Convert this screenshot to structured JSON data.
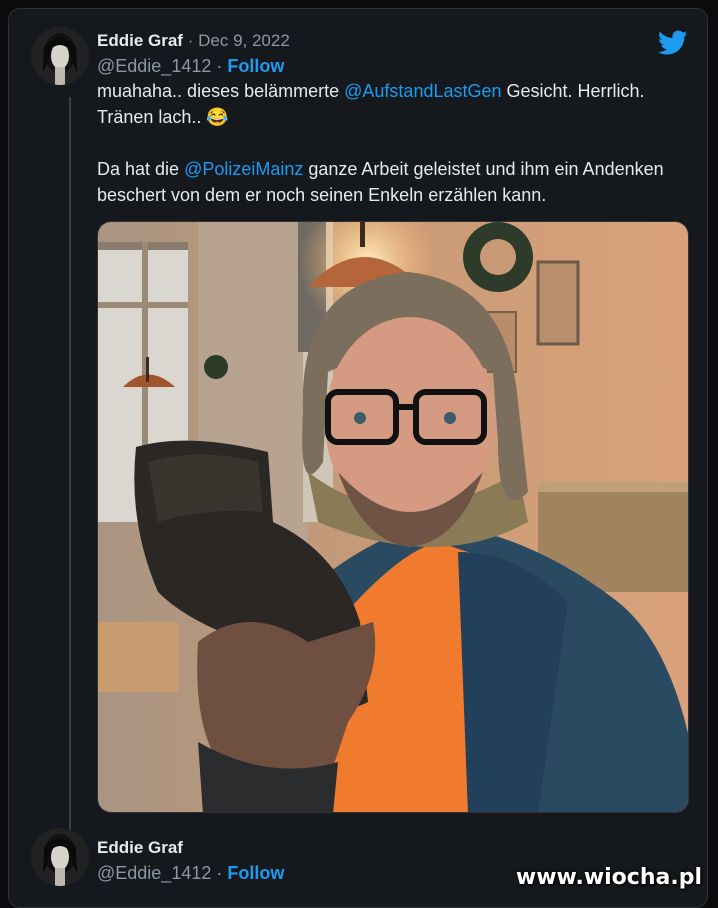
{
  "tweet": {
    "author_name": "Eddie Graf",
    "separator": "·",
    "date": "Dec 9, 2022",
    "handle": "@Eddie_1412",
    "follow_label": "Follow",
    "line1_pre": "muahaha.. dieses belämmerte ",
    "line1_mention": "@AufstandLastGen",
    "line1_post": "  Gesicht. Herrlich.",
    "line2": "Tränen lach..",
    "line2_emoji": "😂",
    "para2_pre": "Da hat die ",
    "para2_mention": "@PolizeiMainz",
    "para2_post": " ganze Arbeit geleistet und ihm ein Andenken beschert von dem er noch seinen Enkeln erzählen kann."
  },
  "reply": {
    "author_name": "Eddie Graf",
    "handle": "@Eddie_1412",
    "separator": "·",
    "follow_label": "Follow"
  },
  "watermark": "www.wiocha.pl",
  "icons": {
    "platform": "twitter-bird-icon"
  },
  "colors": {
    "accent": "#1d9bf0",
    "background": "#15181c",
    "muted": "#8b98a5"
  }
}
